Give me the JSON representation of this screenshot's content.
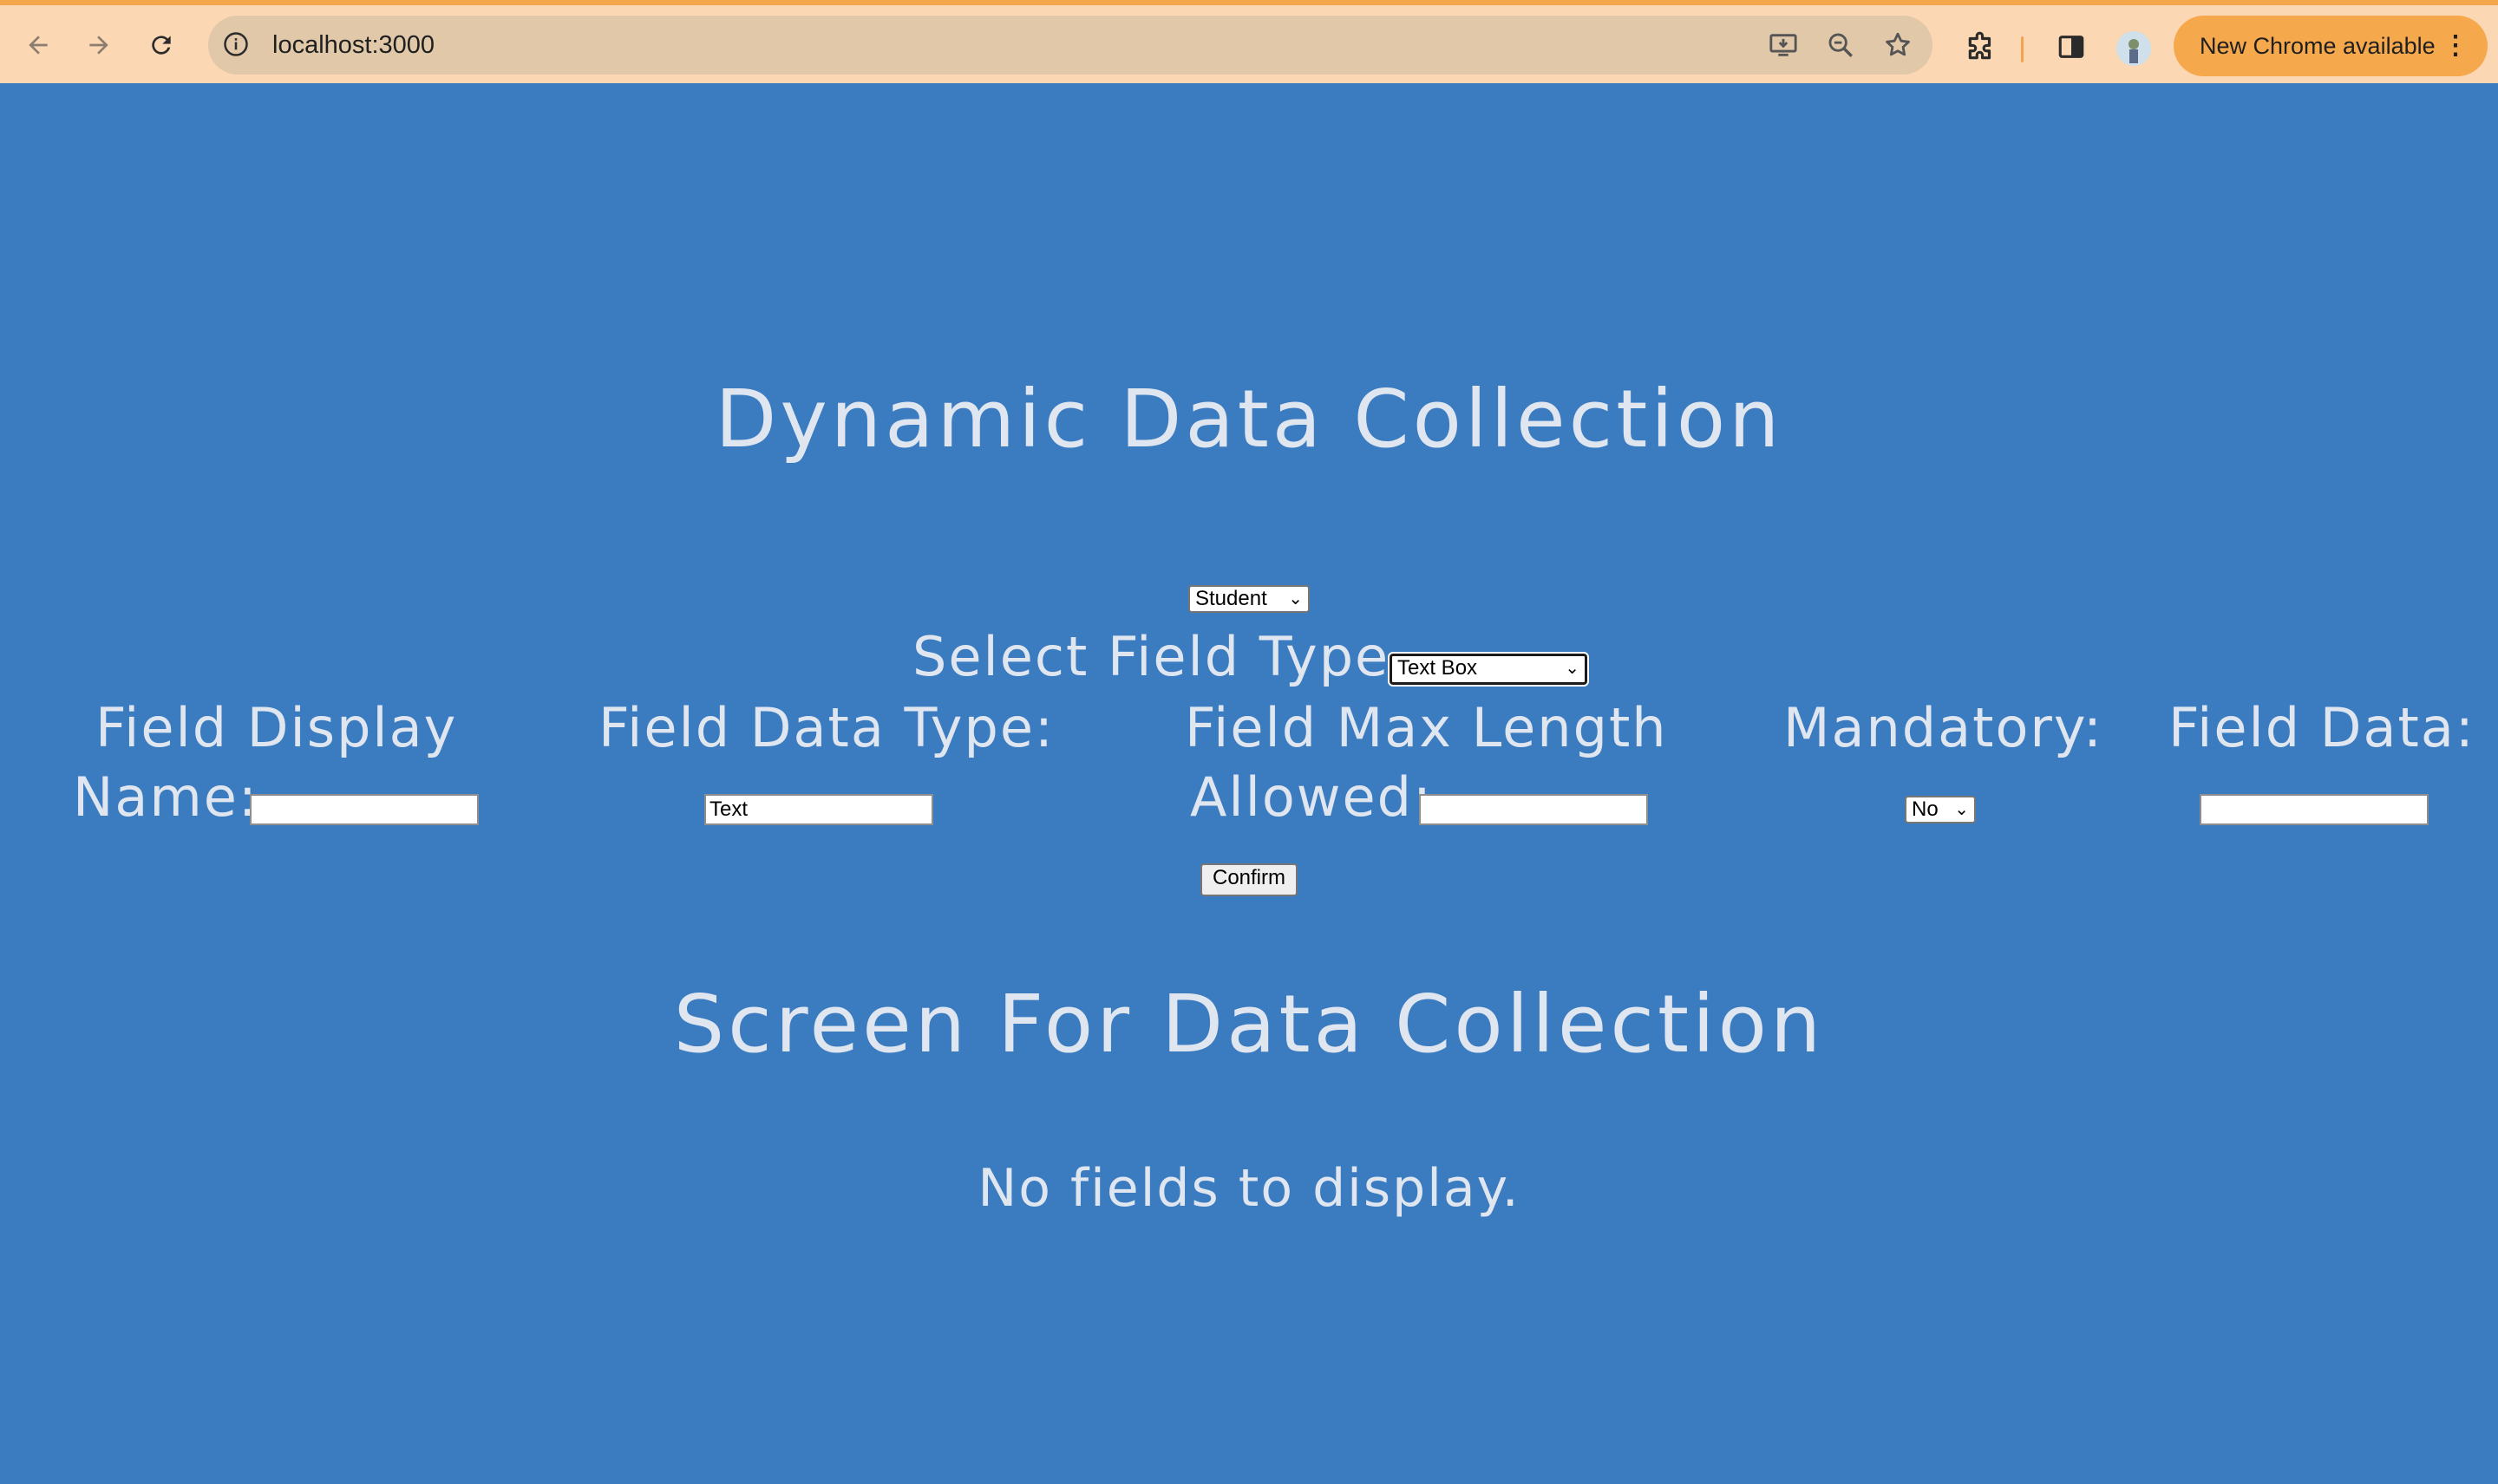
{
  "browser": {
    "url": "localhost:3000",
    "update_label": "New Chrome available",
    "update_menu": "⋮"
  },
  "page": {
    "title": "Dynamic Data Collection",
    "category_select": "Student",
    "field_type_label": "Select Field Type",
    "field_type_select": "Text Box",
    "labels": {
      "display_name_line1": "Field Display",
      "display_name_line2": "Name:",
      "data_type": "Field Data Type:",
      "max_length_line1": "Field Max Length",
      "max_length_line2": "Allowed:",
      "mandatory": "Mandatory:",
      "field_data": "Field Data:"
    },
    "inputs": {
      "display_name": "",
      "data_type": "Text",
      "max_length": "",
      "mandatory": "No",
      "field_data": ""
    },
    "confirm_label": "Confirm",
    "section_title": "Screen For Data Collection",
    "empty_message": "No fields to display."
  },
  "colors": {
    "page_background": "#3b7bc0",
    "heading_text": "#dfe6f0",
    "chrome_background": "#fcd7b3",
    "update_button": "#f6a84d"
  }
}
